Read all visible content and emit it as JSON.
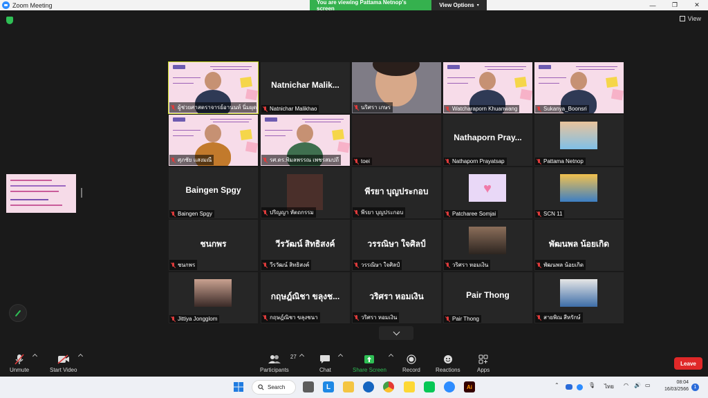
{
  "window": {
    "title": "Zoom Meeting",
    "share_banner": "You are viewing Pattama Netnop's screen",
    "view_options": "View Options",
    "view_label": "View"
  },
  "participants": [
    {
      "name": "ผู้ช่วยศาสตราจารย์อานนท์ นิ่มผุด",
      "display": "",
      "type": "slide"
    },
    {
      "name": "Natnichar Malikhao",
      "display": "Natnichar  Malik...",
      "type": "text"
    },
    {
      "name": "นริศรา เกษร",
      "display": "",
      "type": "video"
    },
    {
      "name": "Watcharaporn Khuanwang",
      "display": "",
      "type": "slide"
    },
    {
      "name": "Sukanya_Boonsri",
      "display": "",
      "type": "slide"
    },
    {
      "name": "ศุภชัย แสงมณี",
      "display": "",
      "type": "slide"
    },
    {
      "name": "รศ.ดร.พิมลพรรณ เพชรสมปถี",
      "display": "",
      "type": "slide"
    },
    {
      "name": "toei",
      "display": "",
      "type": "dark"
    },
    {
      "name": "Nathaporn Prayatsap",
      "display": "Nathaporn  Pray...",
      "type": "text"
    },
    {
      "name": "Pattama Netnop",
      "display": "",
      "type": "avatar"
    },
    {
      "name": "Baingen Spgy",
      "display": "Baingen Spgy",
      "type": "text"
    },
    {
      "name": "ปริญญา หัตถกรรม",
      "display": "",
      "type": "avatar"
    },
    {
      "name": "พีรยา บุญประกอบ",
      "display": "พีรยา บุญประกอบ",
      "type": "text"
    },
    {
      "name": "Patcharee Somjai",
      "display": "",
      "type": "avatar"
    },
    {
      "name": "SCN 11",
      "display": "",
      "type": "avatar"
    },
    {
      "name": "ชนกพร",
      "display": "ชนกพร",
      "type": "text"
    },
    {
      "name": "วีรวัฒน์ สิทธิสงค์",
      "display": "วีรวัฒน์ สิทธิสงค์",
      "type": "text"
    },
    {
      "name": "วรรณิษา ใจศิลป์",
      "display": "วรรณิษา ใจศิลป์",
      "type": "text"
    },
    {
      "name": "วริศรา หอมเงิน",
      "display": "",
      "type": "avatar"
    },
    {
      "name": "พัฒนพล น้อยเกิด",
      "display": "พัฒนพล น้อยเกิด",
      "type": "text"
    },
    {
      "name": "Jittiya Jongglom",
      "display": "",
      "type": "avatar"
    },
    {
      "name": "กฤษฎ์ณิชา ขลุงชนา",
      "display": "กฤษฎ์ณิชา ขลุงช...",
      "type": "text"
    },
    {
      "name": "วริศรา หอมเงิน",
      "display": "วริศรา หอมเงิน",
      "type": "text"
    },
    {
      "name": "Pair Thong",
      "display": "Pair Thong",
      "type": "text"
    },
    {
      "name": "สายพิณ สีหรักษ์",
      "display": "",
      "type": "avatar"
    }
  ],
  "toolbar": {
    "unmute": "Unmute",
    "start_video": "Start Video",
    "participants": "Participants",
    "participants_count": "27",
    "chat": "Chat",
    "share_screen": "Share Screen",
    "record": "Record",
    "reactions": "Reactions",
    "apps": "Apps",
    "leave": "Leave"
  },
  "taskbar": {
    "search": "Search",
    "language": "ไทย",
    "time": "08:04",
    "date": "16/03/2566",
    "notifications": "1"
  },
  "colors": {
    "share_green": "#35b14e",
    "leave_red": "#e02828",
    "active_speaker": "#cde023",
    "share_screen_icon": "#2fbf55"
  }
}
